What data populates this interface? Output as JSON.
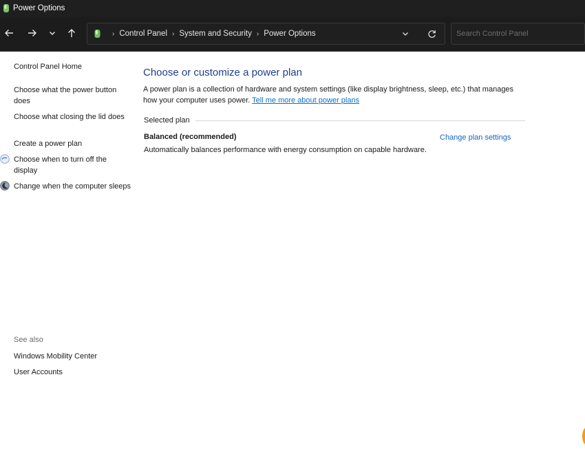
{
  "window": {
    "title": "Power Options"
  },
  "nav": {
    "back_icon": "arrow-left-icon",
    "forward_icon": "arrow-right-icon",
    "recent_icon": "chevron-down-icon",
    "up_icon": "arrow-up-icon"
  },
  "address": {
    "crumbs": [
      "Control Panel",
      "System and Security",
      "Power Options"
    ],
    "separator": "›"
  },
  "search": {
    "placeholder": "Search Control Panel"
  },
  "sidebar": {
    "home": "Control Panel Home",
    "links": [
      "Choose what the power button does",
      "Choose what closing the lid does",
      "Create a power plan",
      "Choose when to turn off the display",
      "Change when the computer sleeps"
    ],
    "see_also_label": "See also",
    "see_also": [
      "Windows Mobility Center",
      "User Accounts"
    ]
  },
  "main": {
    "heading": "Choose or customize a power plan",
    "intro": "A power plan is a collection of hardware and system settings (like display brightness, sleep, etc.) that manages how your computer uses power.",
    "intro_link": "Tell me more about power plans",
    "section_label": "Selected plan",
    "plan_name": "Balanced (recommended)",
    "change_link": "Change plan settings",
    "plan_desc": "Automatically balances performance with energy consumption on capable hardware."
  },
  "colors": {
    "titlebar_bg": "#1f1f1f",
    "heading": "#1e3d8f",
    "link": "#0a6fc2",
    "accent_dot": "#f39b12"
  }
}
